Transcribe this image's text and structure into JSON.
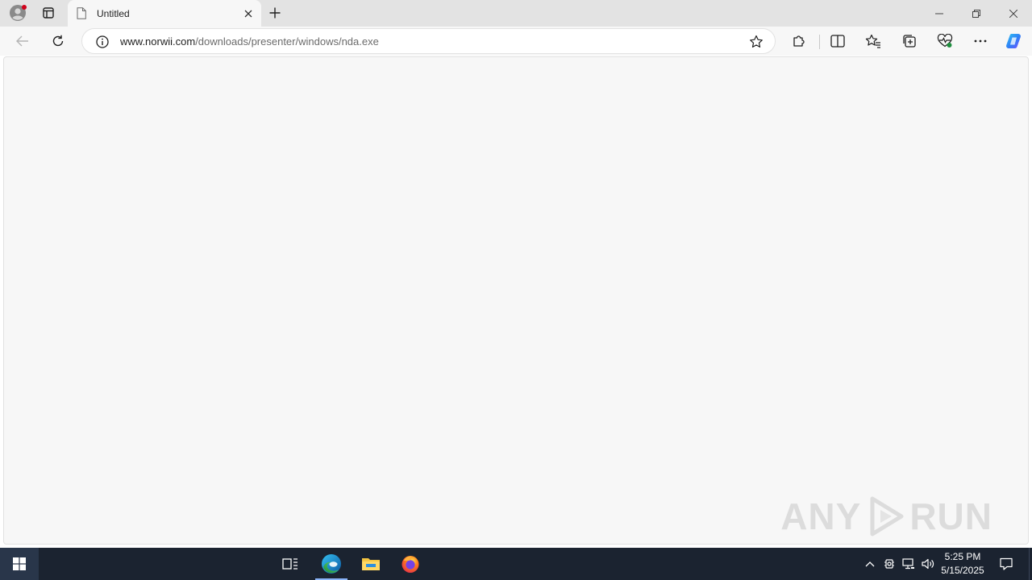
{
  "browser": {
    "tab": {
      "title": "Untitled"
    },
    "address_bar": {
      "host": "www.norwii.com",
      "path": "/downloads/presenter/windows/nda.exe"
    }
  },
  "watermark": {
    "left": "ANY",
    "right": "RUN"
  },
  "taskbar": {
    "clock": {
      "time": "5:25 PM",
      "date": "5/15/2025"
    }
  },
  "colors": {
    "tabstrip": "#e3e3e3",
    "toolbar": "#f7f7f7",
    "content": "#f7f7f7",
    "taskbar": "#1b2330",
    "copilot_accent": "#2f7cf6",
    "edge_accent": "#1aa3e8"
  }
}
